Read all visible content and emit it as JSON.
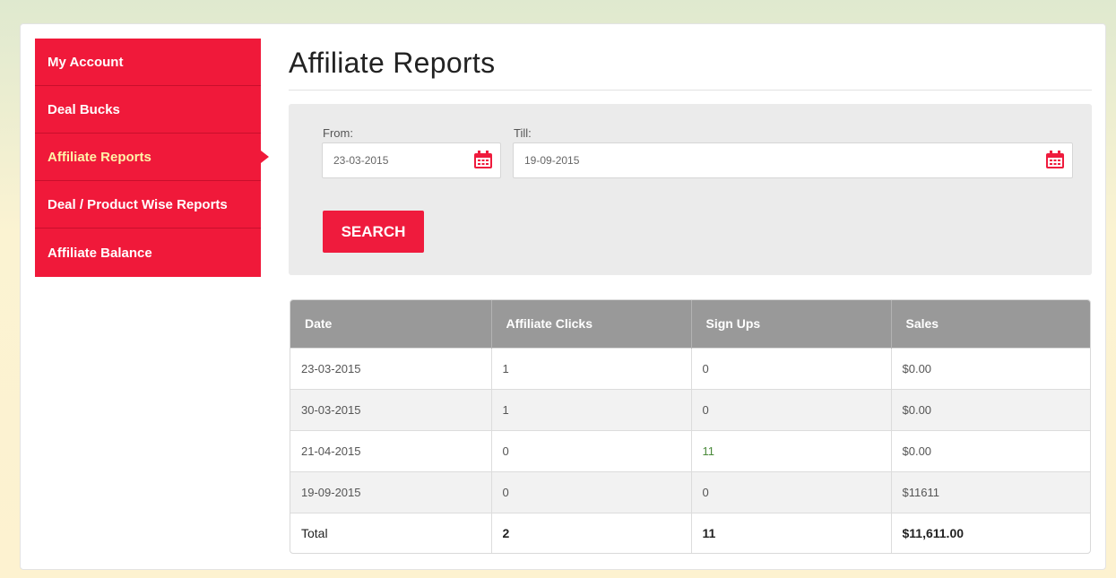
{
  "sidebar": {
    "items": [
      {
        "label": "My Account"
      },
      {
        "label": "Deal Bucks"
      },
      {
        "label": "Affiliate Reports"
      },
      {
        "label": "Deal / Product Wise Reports"
      },
      {
        "label": "Affiliate Balance"
      }
    ],
    "active_index": 2
  },
  "page": {
    "title": "Affiliate Reports"
  },
  "filter": {
    "from_label": "From:",
    "from_value": "23-03-2015",
    "till_label": "Till:",
    "till_value": "19-09-2015",
    "search_label": "SEARCH",
    "calendar_icon": "calendar-icon"
  },
  "table": {
    "headers": [
      "Date",
      "Affiliate Clicks",
      "Sign Ups",
      "Sales"
    ],
    "rows": [
      [
        "23-03-2015",
        "1",
        "0",
        "$0.00"
      ],
      [
        "30-03-2015",
        "1",
        "0",
        "$0.00"
      ],
      [
        "21-04-2015",
        "0",
        "11",
        "$0.00"
      ],
      [
        "19-09-2015",
        "0",
        "0",
        "$11611"
      ]
    ],
    "total": [
      "Total",
      "2",
      "11",
      "$11,611.00"
    ]
  },
  "colors": {
    "accent": "#f0193a",
    "header_bg": "#999999"
  }
}
